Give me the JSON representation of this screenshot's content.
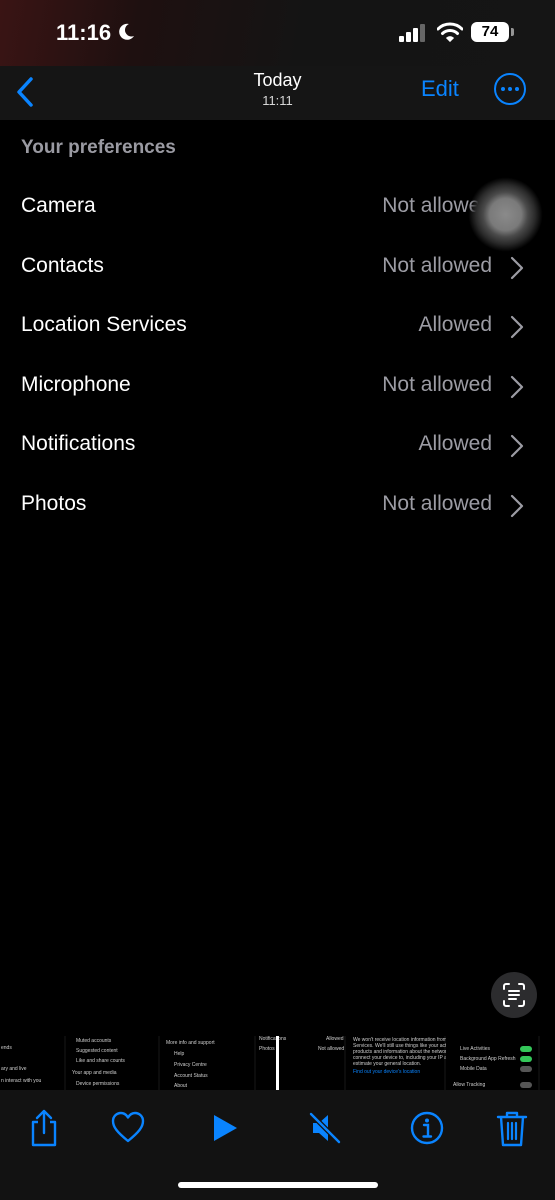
{
  "status_bar": {
    "time": "11:16",
    "battery": "74"
  },
  "nav": {
    "title": "Today",
    "subtitle": "11:11",
    "edit_label": "Edit"
  },
  "preferences": {
    "header": "Your preferences",
    "items": [
      {
        "label": "Camera",
        "value": "Not allowed"
      },
      {
        "label": "Contacts",
        "value": "Not allowed"
      },
      {
        "label": "Location Services",
        "value": "Allowed"
      },
      {
        "label": "Microphone",
        "value": "Not allowed"
      },
      {
        "label": "Notifications",
        "value": "Allowed"
      },
      {
        "label": "Photos",
        "value": "Not allowed"
      }
    ]
  },
  "thumbnails": {
    "t1": [
      "ends",
      "ary and live",
      "n interact with you"
    ],
    "t2": [
      "Muted accounts",
      "Suggested content",
      "Like and share counts",
      "Your app and media",
      "Device permissions"
    ],
    "t3": [
      "More info and support",
      "Help",
      "Privacy Centre",
      "Account Status",
      "About"
    ],
    "t4": [
      "Notifications",
      "Photos",
      "Allowed",
      "Not allowed"
    ],
    "t5": [
      "We won't receive location information from Location",
      "Services. We'll still use things like your activity on our",
      "products and information about the network you",
      "connect your device to, including your IP address, to",
      "estimate your general location.",
      "Find out your device's location"
    ],
    "t6": [
      "Live Activities",
      "Background App Refresh",
      "Mobile Data",
      "Allow Tracking"
    ]
  },
  "icons": {
    "back": "chevron-left-icon",
    "more": "ellipsis-circle-icon",
    "live_text": "live-text-icon",
    "share": "share-icon",
    "favorite": "heart-icon",
    "play": "play-icon",
    "mute": "speaker-slash-icon",
    "info": "info-icon",
    "delete": "trash-icon"
  },
  "colors": {
    "accent": "#0a84ff",
    "background": "#000000",
    "secondary_text": "#9c9ca4"
  }
}
